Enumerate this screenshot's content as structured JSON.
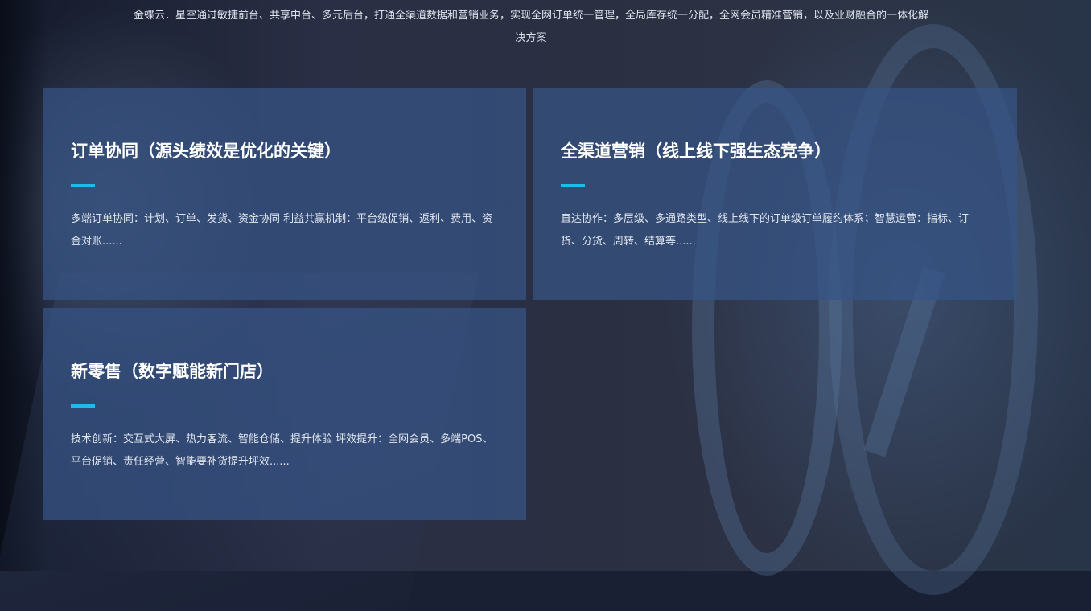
{
  "intro": {
    "text": "金蝶云．星空通过敏捷前台、共享中台、多元后台，打通全渠道数据和营销业务，实现全网订单统一管理，全局库存统一分配，全网会员精准营销，以及业财融合的一体化解决方案"
  },
  "cards": [
    {
      "title": "订单协同（源头绩效是优化的关键）",
      "description": "多端订单协同：计划、订单、发货、资金协同 利益共赢机制：平台级促销、返利、费用、资金对账......"
    },
    {
      "title": "全渠道营销（线上线下强生态竞争）",
      "description": "直达协作：多层级、多通路类型、线上线下的订单级订单履约体系；智慧运营：指标、订货、分货、周转、结算等......"
    },
    {
      "title": "新零售（数字赋能新门店）",
      "description": "技术创新：交互式大屏、热力客流、智能仓储、提升体验 坪效提升：全网会员、多端POS、平台促销、责任经营、智能要补货提升坪效......"
    }
  ],
  "colors": {
    "accent": "#1fb8f0",
    "card": "#365486"
  }
}
